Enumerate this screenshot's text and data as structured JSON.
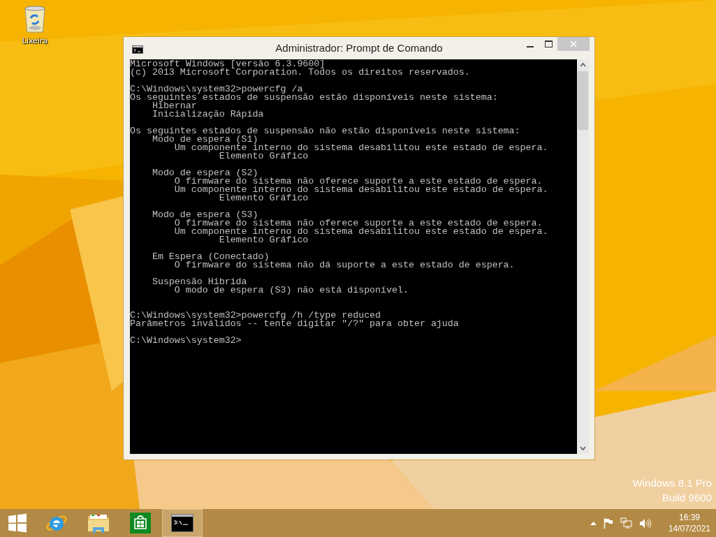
{
  "desktop": {
    "icons": [
      {
        "label": "Lixeira"
      }
    ],
    "edition": {
      "name": "Windows 8.1 Pro",
      "build": "Build 9600"
    }
  },
  "window": {
    "title": "Administrador: Prompt de Comando",
    "console": {
      "lines": [
        {
          "kind": "text",
          "text": "Microsoft Windows [versão 6.3.9600]"
        },
        {
          "kind": "text",
          "text": "(c) 2013 Microsoft Corporation. Todos os direitos reservados."
        },
        {
          "kind": "blank"
        },
        {
          "kind": "text",
          "text": "C:\\Windows\\system32>powercfg /a"
        },
        {
          "kind": "text",
          "text": "Os seguintes estados de suspensão estão disponíveis neste sistema:"
        },
        {
          "kind": "text",
          "text": "    Hibernar"
        },
        {
          "kind": "text",
          "text": "    Inicialização Rápida"
        },
        {
          "kind": "blank"
        },
        {
          "kind": "text",
          "text": "Os seguintes estados de suspensão não estão disponíveis neste sistema:"
        },
        {
          "kind": "text",
          "text": "    Modo de espera (S1)"
        },
        {
          "kind": "text",
          "text": "        Um componente interno do sistema desabilitou este estado de espera."
        },
        {
          "kind": "text",
          "text": "                Elemento Gráfico"
        },
        {
          "kind": "blank"
        },
        {
          "kind": "text",
          "text": "    Modo de espera (S2)"
        },
        {
          "kind": "text",
          "text": "        O firmware do sistema não oferece suporte a este estado de espera."
        },
        {
          "kind": "text",
          "text": "        Um componente interno do sistema desabilitou este estado de espera."
        },
        {
          "kind": "text",
          "text": "                Elemento Gráfico"
        },
        {
          "kind": "blank"
        },
        {
          "kind": "text",
          "text": "    Modo de espera (S3)"
        },
        {
          "kind": "text",
          "text": "        O firmware do sistema não oferece suporte a este estado de espera."
        },
        {
          "kind": "text",
          "text": "        Um componente interno do sistema desabilitou este estado de espera."
        },
        {
          "kind": "text",
          "text": "                Elemento Gráfico"
        },
        {
          "kind": "blank"
        },
        {
          "kind": "text",
          "text": "    Em Espera (Conectado)"
        },
        {
          "kind": "text",
          "text": "        O firmware do sistema não dá suporte a este estado de espera."
        },
        {
          "kind": "blank"
        },
        {
          "kind": "text",
          "text": "    Suspensão Híbrida"
        },
        {
          "kind": "text",
          "text": "        O modo de espera (S3) não está disponível."
        },
        {
          "kind": "blank"
        },
        {
          "kind": "blank"
        },
        {
          "kind": "text",
          "text": "C:\\Windows\\system32>powercfg /h /type reduced"
        },
        {
          "kind": "text",
          "text": "Parâmetros inválidos -- tente digitar \"/?\" para obter ajuda"
        },
        {
          "kind": "blank"
        },
        {
          "kind": "text",
          "text": "C:\\Windows\\system32>"
        }
      ]
    }
  },
  "taskbar": {
    "apps": [
      {
        "kind": "ie",
        "selected": false
      },
      {
        "kind": "explorer",
        "selected": false
      },
      {
        "kind": "store",
        "selected": false
      },
      {
        "kind": "cmd",
        "selected": true
      }
    ],
    "clock": {
      "time": "16:39",
      "date": "14/07/2021"
    }
  }
}
